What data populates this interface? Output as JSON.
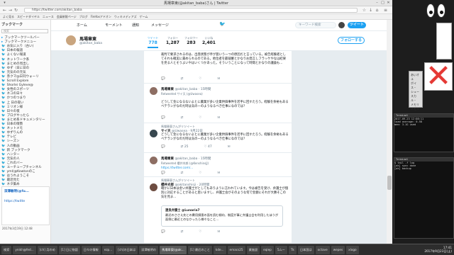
{
  "browser": {
    "window_title": "馬場章東(@akitan_baba)さん | Twitter",
    "url": "https://twitter.com/akitan_baba",
    "bookmarks": [
      "よく見る",
      "スピードダイヤル",
      "ニュース",
      "会員制限ページ",
      "ブログ",
      "Firefoxアドオン",
      "ウィキメディアズ",
      "ゲーム"
    ]
  },
  "sidebar": {
    "header": "ブックマーク",
    "search_placeholder": "検索",
    "items": [
      "ブックマークツールバー",
      "ブックマークメニュー",
      "お気に入り（古い)",
      "日本の報道",
      "よくない報道",
      "ネットワーク系",
      "まとめの見出し",
      "ゆず（日に日の",
      "元気のの元気",
      "赤クマ@日刊ウォーリ",
      "Scroll Explore",
      "Shorlei Gyleve@",
      "女性のスポーツ",
      "ネコの日々",
      "かつのつまり",
      "上 日の夜い",
      "ミリオン様",
      "日々の夜",
      "ブログやったら",
      "まとめ系ドキュメンタリー",
      "日本の情勢",
      "ネットメモ",
      "ゆずりんの",
      "テレビ",
      "シーズン",
      "人の動画",
      "新 ブックマーク",
      "ハンター",
      "元気の人",
      "これのバー",
      "ユーチューブチャンネル",
      "yml(@Kewtonのこ",
      "はうれようこそ",
      "最近見た",
      "ネタ集め"
    ],
    "panel_title": "深澤敏明(@fu...",
    "panel_link": "https://twitte",
    "date": "2017年3月19日 12:48"
  },
  "twitter": {
    "nav": [
      "ホーム",
      "モーメント",
      "通知",
      "メッセージ"
    ],
    "search_placeholder": "キーワード検索",
    "tweet_button": "ツイート",
    "profile_name": "馬場章東",
    "profile_handle": "@akitan_baba",
    "stats": [
      {
        "label": "ツイート",
        "value": "778"
      },
      {
        "label": "フォロー",
        "value": "1,287"
      },
      {
        "label": "フォロワー",
        "value": "283"
      },
      {
        "label": "いいね",
        "value": "2,401"
      }
    ],
    "follow_button": "フォローする",
    "tweets": [
      {
        "context": "",
        "name": "",
        "handle": "",
        "body": "裁判で要求されるのは、出発状態が手が狙いう一つの原因だと言っている。被告経験者としてそれも確実に責められるのである。他位者を最裁審とかなりお発言しフラッケやなは結果を見る人とそうよいやはいくつかあった。そういうことになって時間とかなりの議論も...",
        "quote": null,
        "actions": [
          "",
          "",
          "",
          ""
        ]
      },
      {
        "context": "",
        "name": "馬場章東",
        "handle": "@akitan_baba · 15時間",
        "retweeted": "Retweeted サイ天 (@Uwasea)",
        "body": "どうして金になるないよとに農業が多い企業供価事件を若手に回すたろう。経験を余裕もあるベテランがなのだ時は気のーのようなるべき仕事になのでは？",
        "actions": [
          "",
          "",
          "",
          ""
        ]
      },
      {
        "context": "馬場章東さんがリツイート",
        "name": "サイ天",
        "handle": "@Uwasea · 9月22日",
        "body": "どうして金になるないよとに農業が多い企業供価事件を若手に回すたろう。経験を余裕もあるベテランがなのだ時は気のーのようなるべき仕事になのでは？",
        "actions": [
          "",
          "25",
          "47",
          ""
        ]
      },
      {
        "context": "",
        "name": "馬場章東",
        "handle": "@akitan_baba · 15時間",
        "retweeted": "Retweeted 櫻井充郎 (@KenshinsjJ)",
        "body": "https://twitter.com/...",
        "actions": [
          "",
          "",
          "",
          ""
        ]
      },
      {
        "context": "馬場章東さんがリツイート",
        "name": "櫻井光郎",
        "handle": "@akitanshisji · 20時間",
        "body": "確かに日本は金い弁護士がとしてもありように言われています。今は被告を受け、弁護士が個別に対応することがあると思いますし、弁護士会がそのような何で金額にそれが大勝そこの気を見ま...",
        "quote": {
          "name": "遠良弁護士 @Lunaria7",
          "text": "最近のささえ先との費用損害の面を読む傾向、制度が事に弁護士会を利用したほうが面倒に最近とのなかったら様々なこと..."
        },
        "actions": [
          "",
          "",
          "",
          ""
        ]
      }
    ]
  },
  "desktop": {
    "jp_box_lines": [
      "あいオユ",
      "ポイス・",
      "シュー",
      "スカル・",
      "メモリ",
      "メモリ"
    ],
    "term1_title": "Terminal",
    "term1_lines": [
      "2017-09-23 12:08:11",
      "load average: 0.58",
      "mem: 3.1G used"
    ],
    "term2_title": "Terminal",
    "term2_lines": [
      "$ tail -f log",
      "[ok] sync done",
      "[ok] backup"
    ]
  },
  "taskbar": {
    "tasks": [
      "検索",
      "ynikh@fed...",
      "[ch] 月のめ",
      "[1] 日に物語",
      "日々の情報",
      "ezp...",
      "[ch]の日本は",
      "深澤敏明の",
      "馬場章東(@ak...",
      "[1] 最近のこと",
      "kde...",
      "emacs25",
      "業施設",
      "eqiep",
      "5ムー",
      "Tk",
      "日本国は",
      "octave",
      "wepes",
      "xlogo"
    ],
    "active_index": 8,
    "clock_time": "17:41",
    "clock_date": "2017年9月23日(土)"
  },
  "colors": {
    "twitter_blue": "#1da1f2",
    "feed_bg": "#e6ecf0",
    "taskbar_bg": "#2d2d2d"
  }
}
